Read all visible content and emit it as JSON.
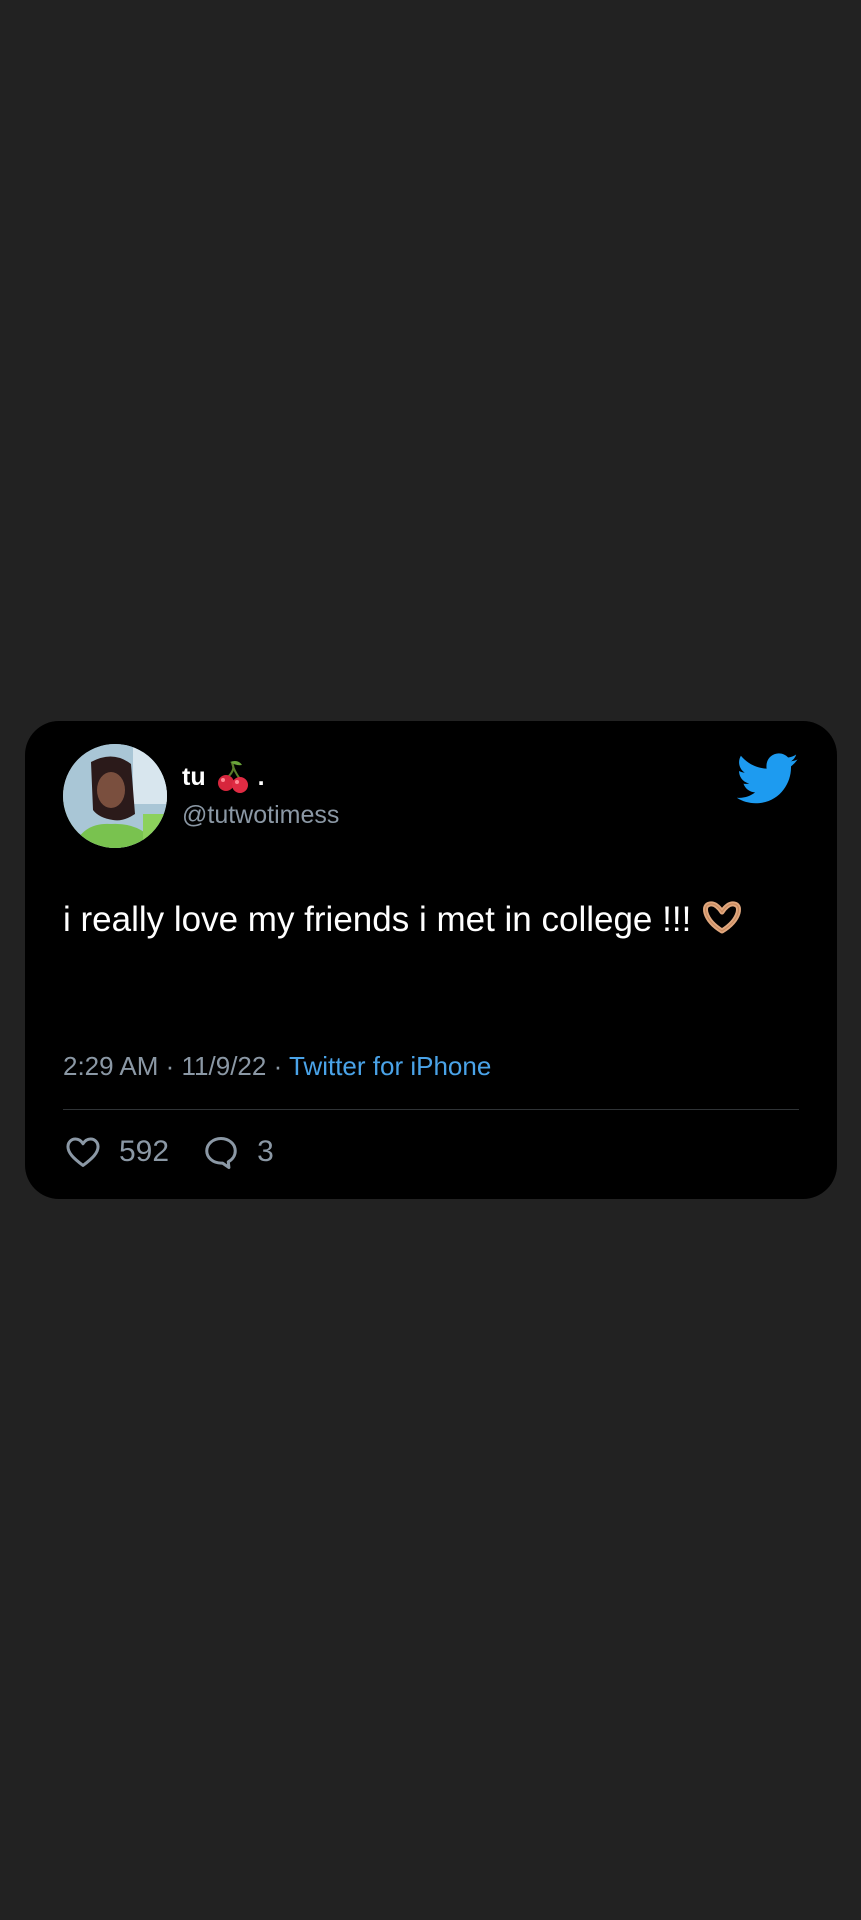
{
  "tweet": {
    "display_name": "tu",
    "display_suffix": ".",
    "display_emoji": "cherries-emoji",
    "username": "@tutwotimess",
    "text": "i really love my friends i met in college !!!",
    "text_emoji": "heart-hands-emoji",
    "time": "2:29 AM",
    "separator": " · ",
    "date": "11/9/22",
    "source": "Twitter for iPhone",
    "likes": "592",
    "replies": "3"
  },
  "icons": {
    "brand": "twitter-bird-icon",
    "like": "heart-outline-icon",
    "reply": "reply-bubble-icon"
  },
  "colors": {
    "background": "#222222",
    "card": "#000000",
    "text": "#ffffff",
    "muted": "#8b98a5",
    "accent": "#1d9bf0",
    "source_link": "#4aa3e8"
  }
}
